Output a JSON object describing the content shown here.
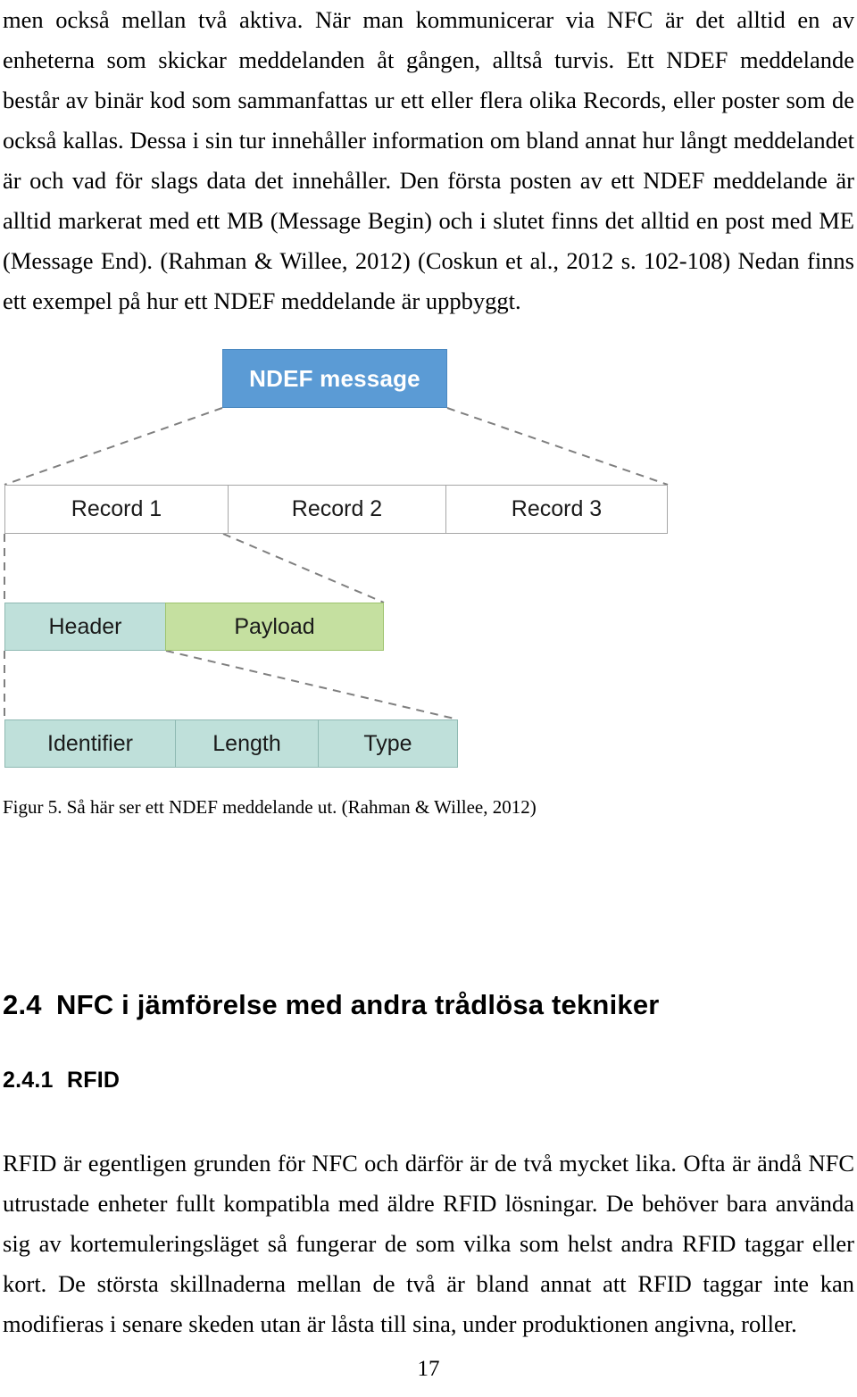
{
  "document": {
    "page_number": "17",
    "paragraph_1": "men också mellan två aktiva. När man kommunicerar via NFC är det alltid en av enheterna som skickar meddelanden åt gången, alltså turvis. Ett NDEF meddelande består av binär kod som sammanfattas ur ett eller flera olika Records, eller poster som de också kallas. Dessa i sin tur innehåller information om bland annat hur långt meddelandet är och vad för slags data det innehåller. Den första posten av ett NDEF meddelande är alltid markerat med ett MB (Message Begin) och i slutet finns det alltid en post med ME (Message End). (Rahman & Willee, 2012) (Coskun et al., 2012 s. 102-108) Nedan finns ett exempel på hur ett NDEF meddelande är uppbyggt.",
    "paragraph_2": "RFID är egentligen grunden för NFC och därför är de två mycket lika. Ofta är ändå NFC utrustade enheter fullt kompatibla med äldre RFID lösningar. De behöver bara använda sig av kortemuleringsläget så fungerar de som vilka som helst andra RFID taggar eller kort. De största skillnaderna mellan de två är bland annat att RFID taggar inte kan modifieras i senare skeden utan är låsta till sina, under produktionen angivna, roller."
  },
  "figure": {
    "caption": "Figur 5. Så här ser ett NDEF meddelande ut. (Rahman & Willee, 2012)",
    "message_box": {
      "label": "NDEF message",
      "color": "#5b9bd5",
      "text_color": "#ffffff"
    },
    "records": [
      {
        "label": "Record 1"
      },
      {
        "label": "Record 2"
      },
      {
        "label": "Record 3"
      }
    ],
    "record_detail": [
      {
        "label": "Header",
        "color": "#bfe0da"
      },
      {
        "label": "Payload",
        "color": "#c5e0a0"
      }
    ],
    "header_detail": [
      {
        "label": "Identifier",
        "color": "#bfe0da"
      },
      {
        "label": "Length",
        "color": "#bfe0da"
      },
      {
        "label": "Type",
        "color": "#bfe0da"
      }
    ],
    "connector_style": "dashed",
    "connector_color": "#7f7f7f"
  },
  "headings": {
    "section": {
      "number": "2.4",
      "title": "NFC i jämförelse med andra trådlösa tekniker"
    },
    "subsection": {
      "number": "2.4.1",
      "title": "RFID"
    }
  }
}
